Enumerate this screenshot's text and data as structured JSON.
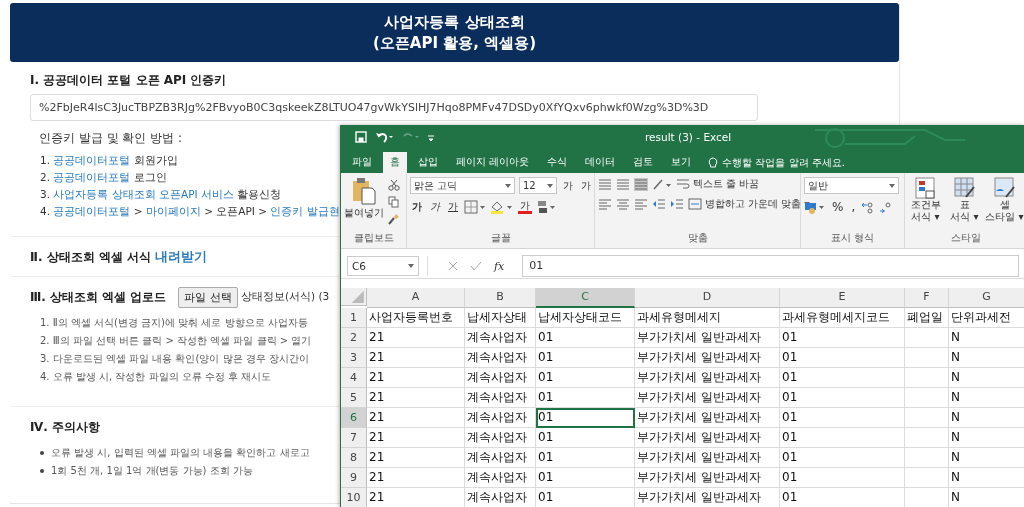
{
  "header": {
    "title": "사업자등록 상태조회",
    "subtitle": "(오픈API 활용, 엑셀용)"
  },
  "sections": [
    {
      "kind": "key",
      "heading": "Ⅰ. 공공데이터 포털 오픈 API 인증키",
      "key_value": "%2FbJeR4lsC3JucTBPZB3RJg%2FBvyoB0C3qskeekZ8LTUO47gvWkYSlHJ7Hqo8PMFv47DSDy0XfYQxv6phwkf0Wzg%3D%3D",
      "steps_title": "인증키 발급 및 확인 방법 :",
      "steps": [
        {
          "number": "1.",
          "parts": [
            {
              "text": "공공데이터포털",
              "link": true
            },
            {
              "text": " 회원가입",
              "link": false
            }
          ]
        },
        {
          "number": "2.",
          "parts": [
            {
              "text": "공공데이터포털",
              "link": true
            },
            {
              "text": " 로그인",
              "link": false
            }
          ]
        },
        {
          "number": "3.",
          "parts": [
            {
              "text": "사업자등록 상태조회 오픈API 서비스",
              "link": true
            },
            {
              "text": " 활용신청",
              "link": false
            }
          ]
        },
        {
          "number": "4.",
          "parts": [
            {
              "text": "공공데이터포털",
              "link": true
            },
            {
              "text": " > ",
              "link": false
            },
            {
              "text": "마이페이지",
              "link": true
            },
            {
              "text": " > 오픈API > ",
              "link": false
            },
            {
              "text": "인증키 발급현",
              "link": true
            }
          ]
        }
      ]
    },
    {
      "kind": "download",
      "heading": "Ⅱ. 상태조회 엑셀 서식",
      "link": "내려받기"
    },
    {
      "kind": "upload",
      "heading": "Ⅲ. 상태조회 엑셀 업로드",
      "button": "파일 선택",
      "file_name": "상태정보(서식) (3",
      "steps": [
        {
          "number": "1.",
          "text": "Ⅱ의 엑셀 서식(변경 금지)에 맞춰 세로 방향으로 사업자등"
        },
        {
          "number": "2.",
          "text": "Ⅲ의 파일 선택 버튼 클릭 > 작성한 엑셀 파일 클릭 > 열기"
        },
        {
          "number": "3.",
          "text": "다운로드된 엑셀 파일 내용 확인(양이 많은 경우 장시간이"
        },
        {
          "number": "4.",
          "text": "오류 발생 시, 작성한 파일의 오류 수정 후 재시도"
        }
      ]
    },
    {
      "kind": "notes",
      "heading": "Ⅳ. 주의사항",
      "bullets": [
        "오류 발생 시, 입력된 엑셀 파일의 내용을 확인하고 새로고",
        "1회 5천 개, 1일 1억 개(변동 가능) 조회 가능"
      ]
    }
  ],
  "excel": {
    "title": "result (3) - Excel",
    "tabs": [
      {
        "label": "파일",
        "selected": false
      },
      {
        "label": "홈",
        "selected": true
      },
      {
        "label": "삽입",
        "selected": false
      },
      {
        "label": "페이지 레이아웃",
        "selected": false
      },
      {
        "label": "수식",
        "selected": false
      },
      {
        "label": "데이터",
        "selected": false
      },
      {
        "label": "검토",
        "selected": false
      },
      {
        "label": "보기",
        "selected": false
      }
    ],
    "tell_me": "수행할 작업을 알려 주세요.",
    "ribbon": {
      "paste": "붙여넣기",
      "clipboard_label": "클립보드",
      "font_name": "맑은 고딕",
      "font_size": "12",
      "grow_shrink": [
        "가",
        "가"
      ],
      "style_buttons": [
        "가",
        "가",
        "가"
      ],
      "font_color": "가",
      "font_label": "글꼴",
      "wrap_text": "텍스트 줄 바꿈",
      "merge_center": "병합하고 가운데 맞춤",
      "alignment_label": "맞춤",
      "number_format": "일반",
      "percent": "%",
      "comma": ",",
      "number_label": "표시 형식",
      "style_buttons_big": [
        [
          "조건부",
          "서식 ▾"
        ],
        [
          "표",
          "서식 ▾"
        ],
        [
          "셀",
          "스타일 ▾"
        ]
      ],
      "styles_label": "스타일"
    },
    "name_box": "C6",
    "fx": "fx",
    "formula": "01",
    "columns": [
      {
        "label": "A",
        "selected": false
      },
      {
        "label": "B",
        "selected": false
      },
      {
        "label": "C",
        "selected": true
      },
      {
        "label": "D",
        "selected": false
      },
      {
        "label": "E",
        "selected": false
      },
      {
        "label": "F",
        "selected": false
      },
      {
        "label": "G",
        "selected": false
      }
    ],
    "rows": [
      {
        "number": "1",
        "selected": false,
        "cells": [
          "사업자등록번호",
          "납세자상태",
          "납세자상태코드",
          "과세유형메세지",
          "과세유형메세지코드",
          "폐업일",
          "단위과세전"
        ]
      },
      {
        "number": "2",
        "selected": false,
        "cells": [
          "21",
          "계속사업자",
          "01",
          "부가가치세 일반과세자",
          "01",
          "",
          "N"
        ]
      },
      {
        "number": "3",
        "selected": false,
        "cells": [
          "21",
          "계속사업자",
          "01",
          "부가가치세 일반과세자",
          "01",
          "",
          "N"
        ]
      },
      {
        "number": "4",
        "selected": false,
        "cells": [
          "21",
          "계속사업자",
          "01",
          "부가가치세 일반과세자",
          "01",
          "",
          "N"
        ]
      },
      {
        "number": "5",
        "selected": false,
        "cells": [
          "21",
          "계속사업자",
          "01",
          "부가가치세 일반과세자",
          "01",
          "",
          "N"
        ]
      },
      {
        "number": "6",
        "selected": true,
        "cells": [
          "21",
          "계속사업자",
          "01",
          "부가가치세 일반과세자",
          "01",
          "",
          "N"
        ]
      },
      {
        "number": "7",
        "selected": false,
        "cells": [
          "21",
          "계속사업자",
          "01",
          "부가가치세 일반과세자",
          "01",
          "",
          "N"
        ]
      },
      {
        "number": "8",
        "selected": false,
        "cells": [
          "21",
          "계속사업자",
          "01",
          "부가가치세 일반과세자",
          "01",
          "",
          "N"
        ]
      },
      {
        "number": "9",
        "selected": false,
        "cells": [
          "21",
          "계속사업자",
          "01",
          "부가가치세 일반과세자",
          "01",
          "",
          "N"
        ]
      },
      {
        "number": "10",
        "selected": false,
        "cells": [
          "21",
          "계속사업자",
          "01",
          "부가가치세 일반과세자",
          "01",
          "",
          "N"
        ]
      }
    ]
  }
}
